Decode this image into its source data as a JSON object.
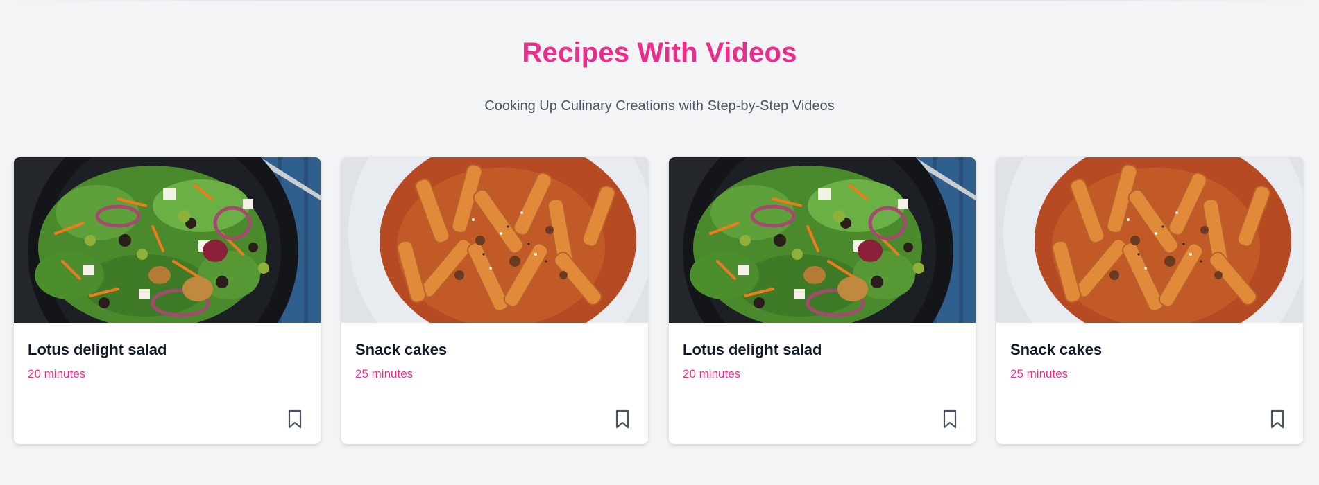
{
  "section": {
    "title": "Recipes With Videos",
    "subtitle": "Cooking Up Culinary Creations with Step-by-Step Videos"
  },
  "colors": {
    "accent": "#ec2d8b",
    "background": "#f3f4f6",
    "card_title": "#111827",
    "subtitle": "#4b5563"
  },
  "recipes": [
    {
      "title": "Lotus delight salad",
      "duration": "20 minutes",
      "image": "salad-photo",
      "bookmark_icon": "bookmark-icon"
    },
    {
      "title": "Snack cakes",
      "duration": "25 minutes",
      "image": "pasta-photo",
      "bookmark_icon": "bookmark-icon"
    },
    {
      "title": "Lotus delight salad",
      "duration": "20 minutes",
      "image": "salad-photo",
      "bookmark_icon": "bookmark-icon"
    },
    {
      "title": "Snack cakes",
      "duration": "25 minutes",
      "image": "pasta-photo",
      "bookmark_icon": "bookmark-icon"
    }
  ]
}
